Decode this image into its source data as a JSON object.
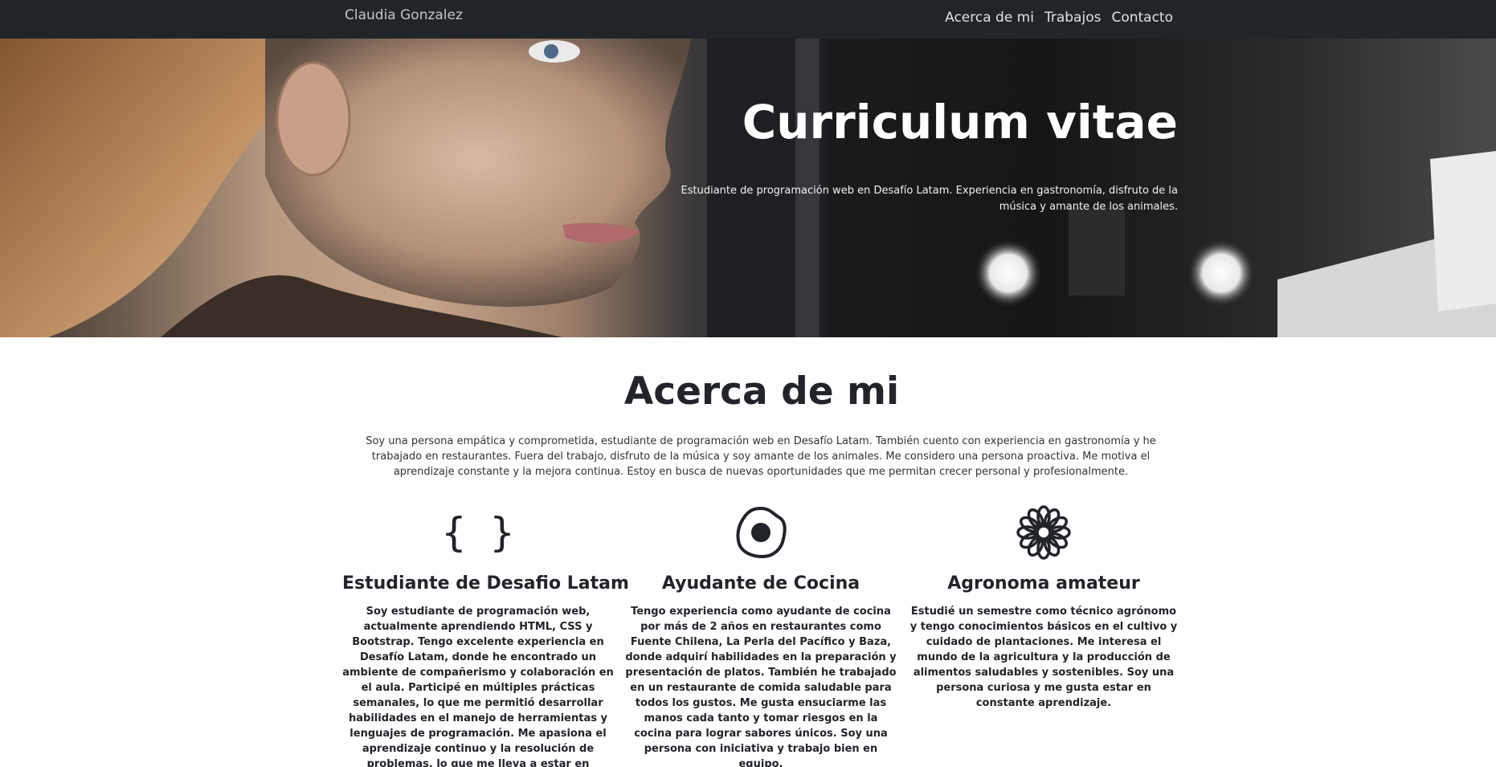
{
  "navbar": {
    "brand": "Claudia Gonzalez",
    "links": [
      "Acerca de mi",
      "Trabajos",
      "Contacto"
    ]
  },
  "hero": {
    "title": "Curriculum vitae",
    "subtitle": "Estudiante de programación web en Desafío Latam. Experiencia en gastronomía, disfruto de la música y amante de los animales."
  },
  "about": {
    "title": "Acerca de mi",
    "text": "Soy una persona empática y comprometida, estudiante de programación web en Desafío Latam. También cuento con experiencia en gastronomía y he trabajado en restaurantes. Fuera del trabajo, disfruto de la música y soy amante de los animales. Me considero una persona proactiva. Me motiva el aprendizaje constante y la mejora continua. Estoy en busca de nuevas oportunidades que me permitan crecer personal y profesionalmente."
  },
  "features": [
    {
      "icon": "code-braces-icon",
      "icon_glyph": "{ }",
      "title": "Estudiante de Desafio Latam",
      "text": "Soy estudiante de programación web, actualmente aprendiendo HTML, CSS y Bootstrap. Tengo excelente experiencia en Desafío Latam, donde he encontrado un ambiente de compañerismo y colaboración en el aula. Participé en múltiples prácticas semanales, lo que me permitió desarrollar habilidades en el manejo de herramientas y lenguajes de programación. Me apasiona el aprendizaje continuo y la resolución de problemas, lo que me lleva a estar en constante actualización en la industria. Busco oportunidades"
    },
    {
      "icon": "fried-egg-icon",
      "title": "Ayudante de Cocina",
      "text": "Tengo experiencia como ayudante de cocina por más de 2 años en restaurantes como Fuente Chilena, La Perla del Pacífico y Baza, donde adquirí habilidades en la preparación y presentación de platos. También he trabajado en un restaurante de comida saludable para todos los gustos. Me gusta ensuciarme las manos cada tanto y tomar riesgos en la cocina para lograr sabores únicos. Soy una persona con iniciativa y trabajo bien en equipo."
    },
    {
      "icon": "flower-icon",
      "title": "Agronoma amateur",
      "text": "Estudié un semestre como técnico agrónomo y tengo conocimientos básicos en el cultivo y cuidado de plantaciones. Me interesa el mundo de la agricultura y la producción de alimentos saludables y sostenibles. Soy una persona curiosa y me gusta estar en constante aprendizaje."
    }
  ]
}
